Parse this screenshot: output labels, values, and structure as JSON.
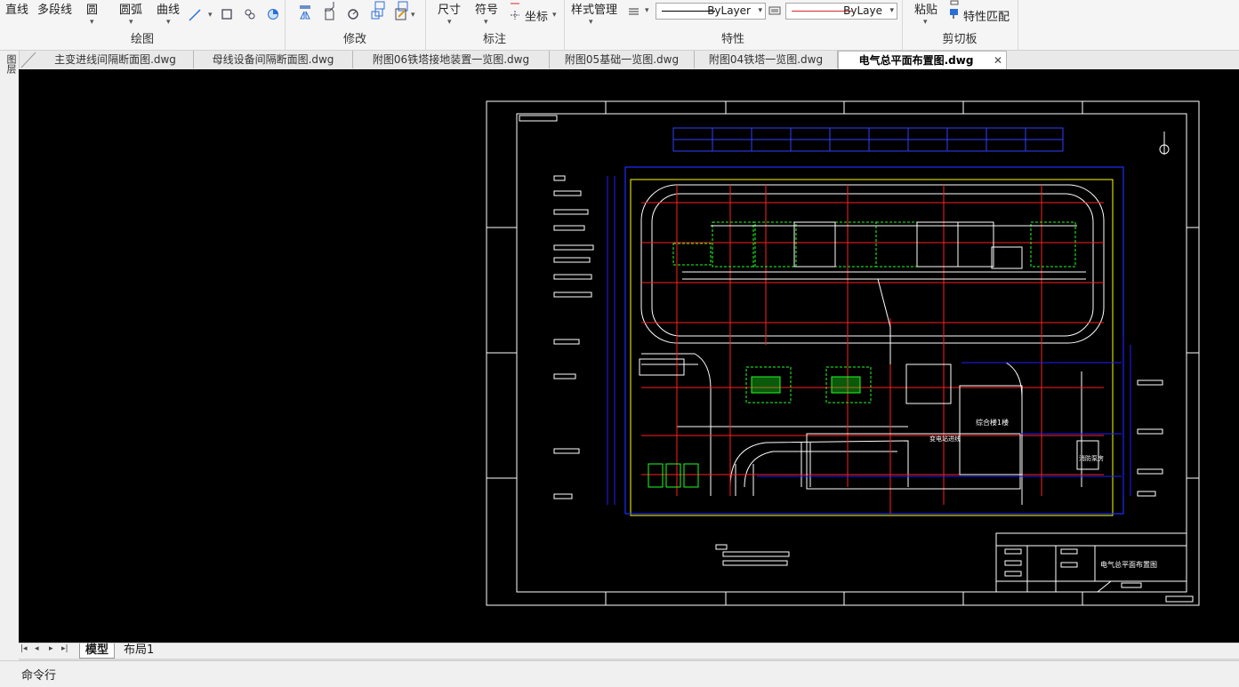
{
  "ribbon": {
    "draw": {
      "line": "直线",
      "polyline": "多段线",
      "circle": "圆",
      "arc": "圆弧",
      "curve": "曲线",
      "title": "绘图"
    },
    "modify": {
      "title": "修改"
    },
    "annotate": {
      "dimension": "尺寸",
      "symbol": "符号",
      "coordinate": "坐标",
      "title": "标注"
    },
    "properties": {
      "style_manager": "样式管理",
      "linetype_value": "ByLayer",
      "color_value": "ByLaye",
      "title": "特性"
    },
    "clipboard": {
      "paste": "粘贴",
      "match_properties": "特性匹配",
      "title": "剪切板"
    }
  },
  "tabs": [
    "主变进线间隔断面图.dwg",
    "母线设备间隔断面图.dwg",
    "附图06铁塔接地装置一览图.dwg",
    "附图05基础一览图.dwg",
    "附图04铁塔一览图.dwg",
    "电气总平面布置图.dwg"
  ],
  "active_tab_index": 5,
  "left_strip_label": "图层",
  "drawing": {
    "title_block_name": "电气总平面布置图",
    "building_labels": [
      "综合楼1楼",
      "消防泵房",
      "变电站进线"
    ]
  },
  "layout_tabs": [
    "模型",
    "布局1"
  ],
  "active_layout": "模型",
  "command_line_label": "命令行",
  "colors": {
    "canvas": "#000000",
    "road": "#ffffff",
    "cable": "#0000ff",
    "grid": "#ff0000",
    "equipment": "#00ff00",
    "boundary": "#ffff00",
    "accent_red": "#d9262c"
  }
}
